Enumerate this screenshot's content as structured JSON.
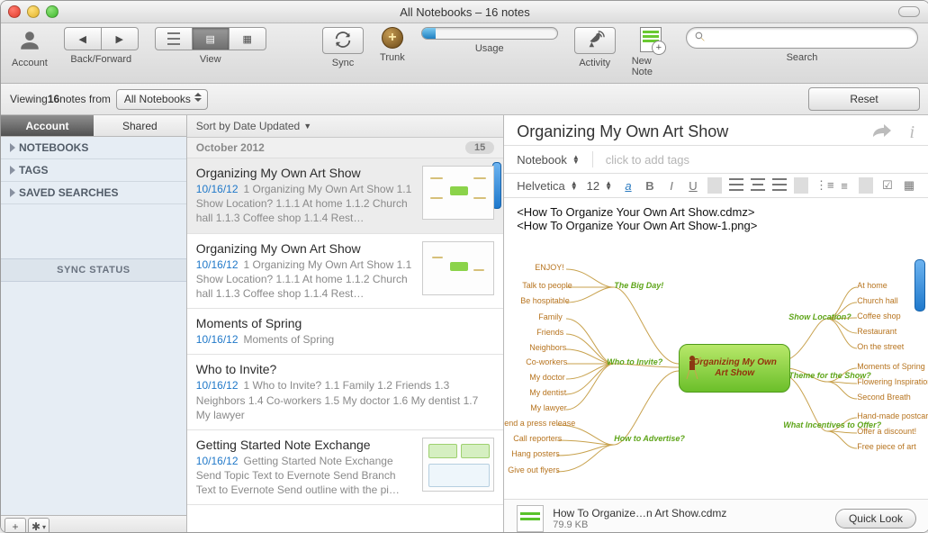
{
  "window": {
    "title": "All Notebooks – 16 notes"
  },
  "toolbar": {
    "account": "Account",
    "backforward": "Back/Forward",
    "view": "View",
    "sync": "Sync",
    "trunk": "Trunk",
    "usage": "Usage",
    "activity": "Activity",
    "newnote": "New Note",
    "search": "Search"
  },
  "filter": {
    "viewing_pre": "Viewing ",
    "count": "16",
    "viewing_post": " notes from",
    "select": "All Notebooks",
    "reset": "Reset"
  },
  "sidebar": {
    "tabs": {
      "account": "Account",
      "shared": "Shared"
    },
    "sections": {
      "notebooks": "NOTEBOOKS",
      "tags": "TAGS",
      "saved": "SAVED SEARCHES"
    },
    "sync_status": "SYNC STATUS"
  },
  "notelist": {
    "sort": "Sort by Date Updated",
    "month": "October 2012",
    "month_count": "15",
    "items": [
      {
        "title": "Organizing My Own Art Show",
        "date": "10/16/12",
        "preview": "1 Organizing My Own Art Show 1.1 Show Location? 1.1.1 At home 1.1.2 Church hall 1.1.3 Coffee shop 1.1.4 Rest…",
        "thumb": true
      },
      {
        "title": "Organizing My Own Art Show",
        "date": "10/16/12",
        "preview": "1 Organizing My Own Art Show 1.1 Show Location? 1.1.1 At home 1.1.2 Church hall 1.1.3 Coffee shop 1.1.4 Rest…",
        "thumb": true
      },
      {
        "title": "Moments of Spring",
        "date": "10/16/12",
        "preview": "Moments of Spring",
        "thumb": false
      },
      {
        "title": "Who to Invite?",
        "date": "10/16/12",
        "preview": "1 Who to Invite? 1.1 Family 1.2 Friends 1.3 Neighbors 1.4 Co-workers 1.5 My doctor 1.6 My dentist 1.7 My lawyer",
        "thumb": false
      },
      {
        "title": "Getting Started Note Exchange",
        "date": "10/16/12",
        "preview": "Getting Started Note Exchange Send Topic Text to Evernote Send Branch Text to Evernote Send outline with the pi…",
        "thumb": true
      }
    ]
  },
  "detail": {
    "title": "Organizing My Own Art Show",
    "notebook_label": "Notebook",
    "tags_placeholder": "click to add tags",
    "font": "Helvetica",
    "fontsize": "12",
    "lines": {
      "l1": "<How To Organize Your Own Art Show.cdmz>",
      "l2": "<How To Organize Your Own Art Show-1.png>"
    },
    "mindmap": {
      "center": "Organizing My Own Art Show",
      "branches": {
        "bigday": {
          "label": "The Big Day!",
          "leaves": [
            "ENJOY!",
            "Talk to people",
            "Be hospitable"
          ]
        },
        "invite": {
          "label": "Who to Invite?",
          "leaves": [
            "Family",
            "Friends",
            "Neighbors",
            "Co-workers",
            "My doctor",
            "My dentist",
            "My lawyer"
          ]
        },
        "advertise": {
          "label": "How to Advertise?",
          "leaves": [
            "Send a press release",
            "Call reporters",
            "Hang posters",
            "Give out flyers"
          ]
        },
        "location": {
          "label": "Show Location?",
          "leaves": [
            "At home",
            "Church hall",
            "Coffee shop",
            "Restaurant",
            "On the street"
          ]
        },
        "theme": {
          "label": "Theme for the Show?",
          "leaves": [
            "Moments of Spring",
            "Flowering Inspiration",
            "Second Breath"
          ]
        },
        "incentives": {
          "label": "What Incentives to Offer?",
          "leaves": [
            "Hand-made postcards",
            "Offer a discount!",
            "Free piece of art"
          ]
        }
      }
    },
    "attachment": {
      "name": "How To Organize…n Art Show.cdmz",
      "size": "79.9 KB",
      "quicklook": "Quick Look"
    }
  }
}
